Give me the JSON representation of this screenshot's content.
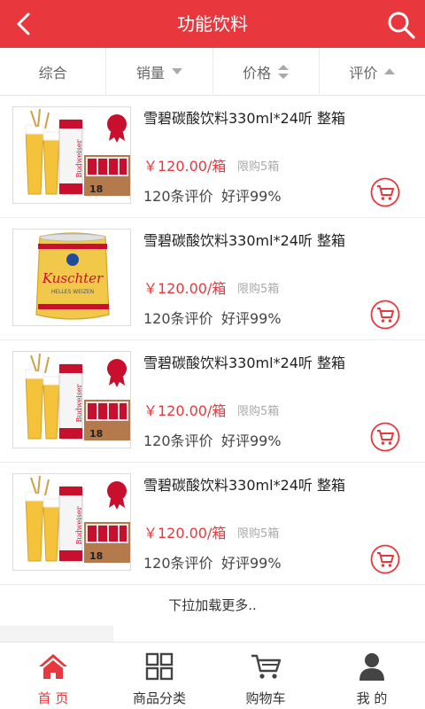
{
  "header": {
    "title": "功能饮料"
  },
  "sort_tabs": [
    {
      "label": "综合"
    },
    {
      "label": "销量"
    },
    {
      "label": "价格"
    },
    {
      "label": "评价"
    }
  ],
  "products": [
    {
      "name": "雪碧碳酸饮料330ml*24听 整箱",
      "price": "￥120.00",
      "unit": "/箱",
      "limit": "限购5箱",
      "reviews": "120条评价",
      "rating": "好评99%",
      "image": "budweiser-beer-image"
    },
    {
      "name": "雪碧碳酸饮料330ml*24听 整箱",
      "price": "￥120.00",
      "unit": "/箱",
      "limit": "限购5箱",
      "reviews": "120条评价",
      "rating": "好评99%",
      "image": "kuschter-keg-image"
    },
    {
      "name": "雪碧碳酸饮料330ml*24听 整箱",
      "price": "￥120.00",
      "unit": "/箱",
      "limit": "限购5箱",
      "reviews": "120条评价",
      "rating": "好评99%",
      "image": "budweiser-beer-image"
    },
    {
      "name": "雪碧碳酸饮料330ml*24听 整箱",
      "price": "￥120.00",
      "unit": "/箱",
      "limit": "限购5箱",
      "reviews": "120条评价",
      "rating": "好评99%",
      "image": "budweiser-beer-image"
    }
  ],
  "load_more": "下拉加载更多..",
  "bottom_nav": [
    {
      "label": "首 页",
      "icon": "home-icon",
      "active": true
    },
    {
      "label": "商品分类",
      "icon": "category-icon",
      "active": false
    },
    {
      "label": "购物车",
      "icon": "cart-icon",
      "active": false
    },
    {
      "label": "我 的",
      "icon": "user-icon",
      "active": false
    }
  ],
  "colors": {
    "primary": "#e8383d",
    "text": "#333333",
    "muted": "#aaaaaa"
  }
}
